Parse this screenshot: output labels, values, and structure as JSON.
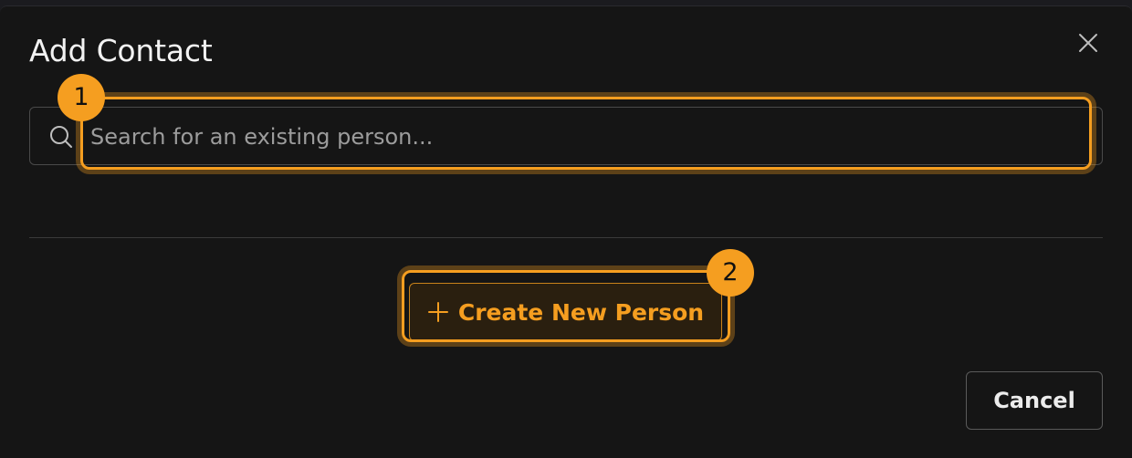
{
  "dialog": {
    "title": "Add Contact",
    "close_icon": "close-icon"
  },
  "search": {
    "icon": "search-icon",
    "placeholder": "Search for an existing person...",
    "value": ""
  },
  "annotations": {
    "badge_1": "1",
    "badge_2": "2",
    "accent_color": "#f59e20"
  },
  "actions": {
    "create_icon": "plus-icon",
    "create_label": "Create New Person",
    "cancel_label": "Cancel"
  }
}
